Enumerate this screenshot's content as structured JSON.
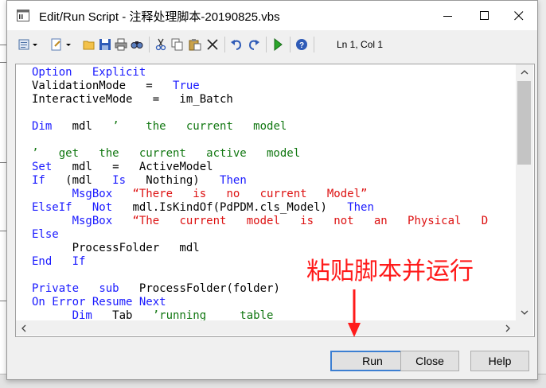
{
  "window": {
    "title": "Edit/Run Script - 注释处理脚本-20190825.vbs"
  },
  "toolbar": {
    "icons": [
      "edit-menu-icon",
      "properties-menu-icon",
      "open-icon",
      "save-icon",
      "print-icon",
      "find-icon",
      "cut-icon",
      "copy-icon",
      "paste-icon",
      "delete-icon",
      "undo-icon",
      "redo-icon",
      "run-icon",
      "help-icon"
    ],
    "position": "Ln 1, Col 1"
  },
  "script": {
    "lines": [
      {
        "segments": [
          {
            "t": "Option   Explicit",
            "c": "kw"
          }
        ]
      },
      {
        "segments": [
          {
            "t": "ValidationMode   =   ",
            "c": "tx"
          },
          {
            "t": "True",
            "c": "kw"
          }
        ]
      },
      {
        "segments": [
          {
            "t": "InteractiveMode   =   im_Batch",
            "c": "tx"
          }
        ]
      },
      {
        "segments": []
      },
      {
        "segments": [
          {
            "t": "Dim",
            "c": "kw"
          },
          {
            "t": "   mdl   ",
            "c": "tx"
          },
          {
            "t": "’    the   current   model",
            "c": "cm"
          }
        ]
      },
      {
        "segments": []
      },
      {
        "segments": [
          {
            "t": "’   get   the   current   active   model",
            "c": "cm"
          }
        ]
      },
      {
        "segments": [
          {
            "t": "Set",
            "c": "kw"
          },
          {
            "t": "   mdl   =   ActiveModel",
            "c": "tx"
          }
        ]
      },
      {
        "segments": [
          {
            "t": "If",
            "c": "kw"
          },
          {
            "t": "   (mdl   ",
            "c": "tx"
          },
          {
            "t": "Is",
            "c": "kw"
          },
          {
            "t": "   Nothing)   ",
            "c": "tx"
          },
          {
            "t": "Then",
            "c": "kw"
          }
        ]
      },
      {
        "segments": [
          {
            "t": "      MsgBox   ",
            "c": "kw"
          },
          {
            "t": "“There   is   no   current   Model”",
            "c": "st"
          }
        ]
      },
      {
        "segments": [
          {
            "t": "ElseIf",
            "c": "kw"
          },
          {
            "t": "   ",
            "c": "tx"
          },
          {
            "t": "Not",
            "c": "kw"
          },
          {
            "t": "   mdl.IsKindOf(PdPDM.cls_Model)   ",
            "c": "tx"
          },
          {
            "t": "Then",
            "c": "kw"
          }
        ]
      },
      {
        "segments": [
          {
            "t": "      MsgBox   ",
            "c": "kw"
          },
          {
            "t": "“The   current   model   is   not   an   Physical   D",
            "c": "st"
          }
        ]
      },
      {
        "segments": [
          {
            "t": "Else",
            "c": "kw"
          }
        ]
      },
      {
        "segments": [
          {
            "t": "      ProcessFolder   mdl",
            "c": "tx"
          }
        ]
      },
      {
        "segments": [
          {
            "t": "End",
            "c": "kw"
          },
          {
            "t": "   ",
            "c": "tx"
          },
          {
            "t": "If",
            "c": "kw"
          }
        ]
      },
      {
        "segments": []
      },
      {
        "segments": [
          {
            "t": "Private",
            "c": "kw"
          },
          {
            "t": "   ",
            "c": "tx"
          },
          {
            "t": "sub",
            "c": "kw"
          },
          {
            "t": "   ProcessFolder(folder)",
            "c": "tx"
          }
        ]
      },
      {
        "segments": [
          {
            "t": "On Error Resume Next",
            "c": "kw"
          }
        ]
      },
      {
        "segments": [
          {
            "t": "      Dim",
            "c": "kw"
          },
          {
            "t": "   Tab   ",
            "c": "tx"
          },
          {
            "t": "’running     table",
            "c": "cm"
          }
        ]
      }
    ]
  },
  "buttons": {
    "run": "Run",
    "close": "Close",
    "help": "Help"
  },
  "annotation": {
    "text": "粘贴脚本并运行"
  },
  "colors": {
    "keyword": "#1a1aff",
    "comment": "#117711",
    "string": "#dd1111",
    "annotation": "#ff1a1a",
    "default_button_border": "#3c7fd2"
  }
}
